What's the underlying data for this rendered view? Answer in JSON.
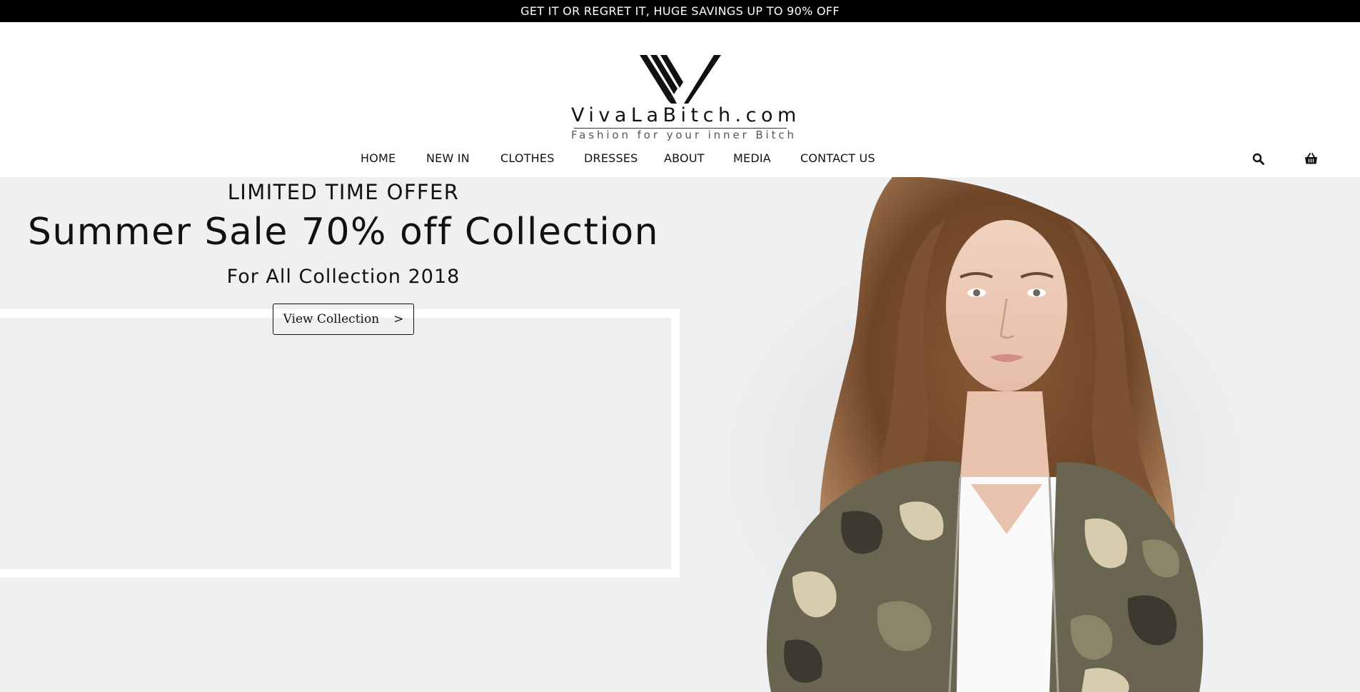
{
  "announcement": {
    "text": "GET IT OR REGRET IT, HUGE SAVINGS UP TO 90% OFF"
  },
  "brand": {
    "name": "VivaLaBitch.com",
    "tagline": "Fashion for your inner Bitch"
  },
  "nav": {
    "items": [
      {
        "label": "HOME"
      },
      {
        "label": "NEW IN"
      },
      {
        "label": "CLOTHES"
      },
      {
        "label": "DRESSES"
      },
      {
        "label": "ABOUT"
      },
      {
        "label": "MEDIA"
      },
      {
        "label": "CONTACT US"
      }
    ],
    "icons": [
      "search-icon",
      "basket-icon"
    ]
  },
  "hero": {
    "kicker": "LIMITED TIME OFFER",
    "title": "Summer Sale 70% off Collection",
    "subtitle": "For All Collection 2018",
    "button_label": "View Collection",
    "button_arrow": ">",
    "image": "model-in-camouflage-jacket"
  },
  "colors": {
    "topbar": "#000000",
    "hero_bg": "#eff0f2",
    "text": "#111111"
  }
}
